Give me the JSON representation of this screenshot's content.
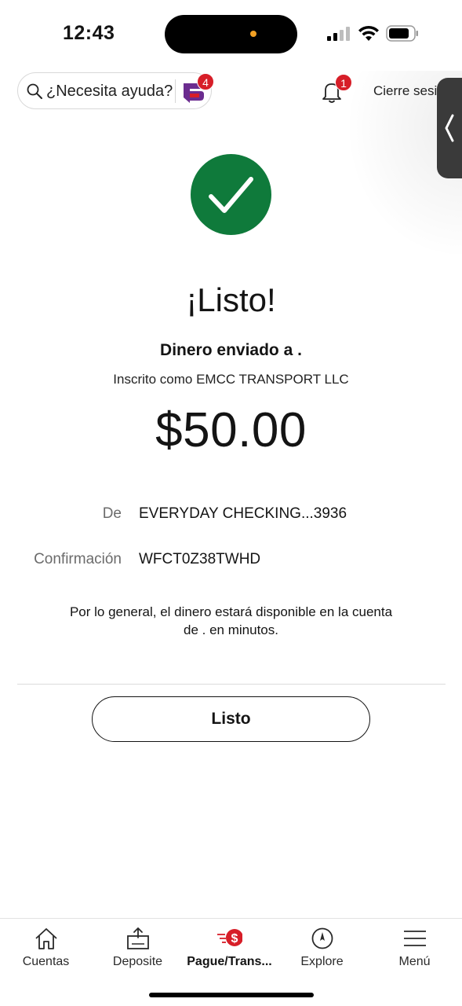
{
  "status_bar": {
    "time": "12:43",
    "icons": [
      "signal-icon",
      "wifi-icon",
      "battery-icon"
    ]
  },
  "header": {
    "help_placeholder": "¿Necesita ayuda?",
    "fargo_badge": "4",
    "notifications_badge": "1",
    "logout_label": "Cierre sesión"
  },
  "confirmation": {
    "title": "¡Listo!",
    "subtitle": "Dinero enviado a .",
    "enrolled_as": "Inscrito como EMCC TRANSPORT LLC",
    "amount": "$50.00",
    "details": [
      {
        "label": "De",
        "value": "EVERYDAY CHECKING...3936"
      },
      {
        "label": "Confirmación",
        "value": "WFCT0Z38TWHD"
      }
    ],
    "availability_note": "Por lo general, el dinero estará disponible en la cuenta de . en minutos.",
    "done_button": "Listo"
  },
  "bottom_nav": {
    "items": [
      {
        "label": "Cuentas",
        "icon": "home-icon"
      },
      {
        "label": "Deposite",
        "icon": "deposit-icon"
      },
      {
        "label": "Pague/Trans...",
        "icon": "pay-transfer-icon",
        "active": true
      },
      {
        "label": "Explore",
        "icon": "compass-icon"
      },
      {
        "label": "Menú",
        "icon": "menu-icon"
      }
    ]
  },
  "colors": {
    "success_green": "#0f7a3b",
    "badge_red": "#d71e28",
    "fargo_purple": "#6b2c8f"
  }
}
